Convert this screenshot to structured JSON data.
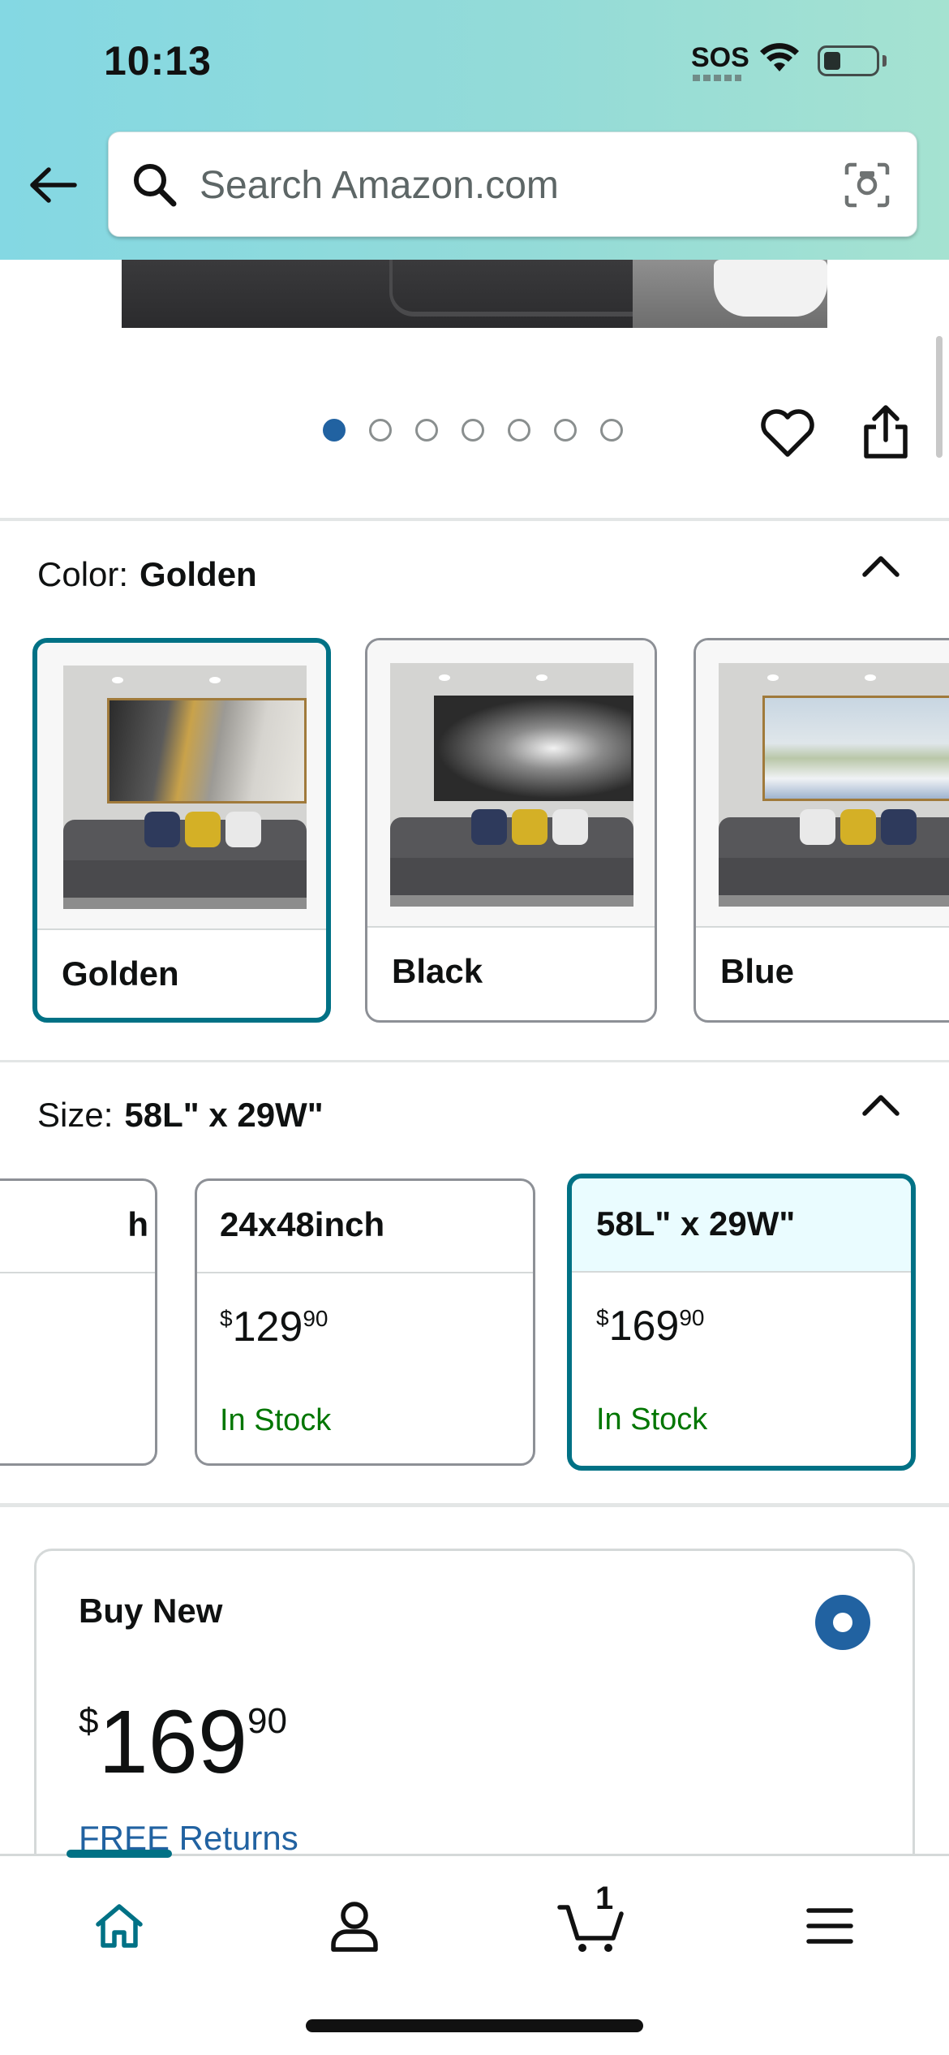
{
  "status_bar": {
    "time": "10:13",
    "sos": "SOS"
  },
  "search": {
    "placeholder": "Search Amazon.com"
  },
  "gallery": {
    "dot_count": 7,
    "active_dot": 1
  },
  "color": {
    "label": "Color:",
    "selected": "Golden",
    "options": [
      {
        "name": "Golden"
      },
      {
        "name": "Black"
      },
      {
        "name": "Blue"
      }
    ]
  },
  "size": {
    "label": "Size:",
    "selected": "58L\" x 29W\"",
    "options": [
      {
        "name": "24x48inch",
        "price_currency": "$",
        "price_whole": "129",
        "price_fraction": "90",
        "stock": "In Stock"
      },
      {
        "name": "58L\" x 29W\"",
        "price_currency": "$",
        "price_whole": "169",
        "price_fraction": "90",
        "stock": "In Stock"
      }
    ],
    "partial_option_suffix": "h"
  },
  "buy_new": {
    "title": "Buy New",
    "price_currency": "$",
    "price_whole": "169",
    "price_fraction": "90",
    "returns": "FREE Returns"
  },
  "bottom_nav": {
    "cart_count": "1"
  },
  "colors": {
    "accent": "#007185",
    "link": "#2162a1",
    "stock": "#007600"
  }
}
